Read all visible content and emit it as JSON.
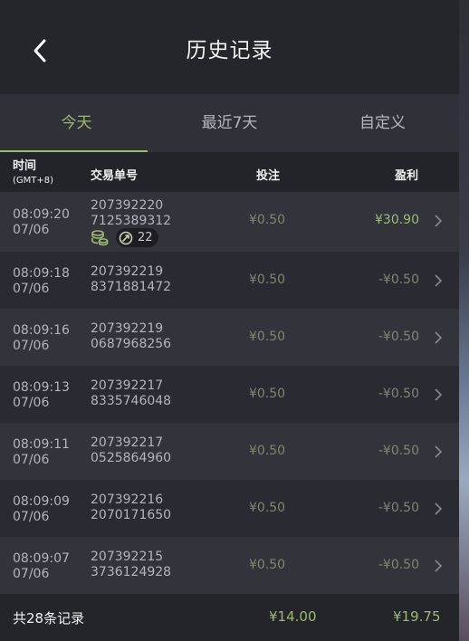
{
  "header": {
    "title": "历史记录"
  },
  "tabs": [
    {
      "label": "今天",
      "active": true
    },
    {
      "label": "最近7天",
      "active": false
    },
    {
      "label": "自定义",
      "active": false
    }
  ],
  "columns": {
    "time": "时间",
    "timezone": "(GMT+8)",
    "order": "交易单号",
    "bet": "投注",
    "profit": "盈利"
  },
  "records": [
    {
      "time": "08:09:20",
      "date": "07/06",
      "order_line1": "207392220",
      "order_line2": "7125389312",
      "bet": "¥0.50",
      "profit": "¥30.90",
      "win": true,
      "badge_count": "22"
    },
    {
      "time": "08:09:18",
      "date": "07/06",
      "order_line1": "207392219",
      "order_line2": "8371881472",
      "bet": "¥0.50",
      "profit": "-¥0.50",
      "win": false
    },
    {
      "time": "08:09:16",
      "date": "07/06",
      "order_line1": "207392219",
      "order_line2": "0687968256",
      "bet": "¥0.50",
      "profit": "-¥0.50",
      "win": false
    },
    {
      "time": "08:09:13",
      "date": "07/06",
      "order_line1": "207392217",
      "order_line2": "8335746048",
      "bet": "¥0.50",
      "profit": "-¥0.50",
      "win": false
    },
    {
      "time": "08:09:11",
      "date": "07/06",
      "order_line1": "207392217",
      "order_line2": "0525864960",
      "bet": "¥0.50",
      "profit": "-¥0.50",
      "win": false
    },
    {
      "time": "08:09:09",
      "date": "07/06",
      "order_line1": "207392216",
      "order_line2": "2070171650",
      "bet": "¥0.50",
      "profit": "-¥0.50",
      "win": false
    },
    {
      "time": "08:09:07",
      "date": "07/06",
      "order_line1": "207392215",
      "order_line2": "3736124928",
      "bet": "¥0.50",
      "profit": "-¥0.50",
      "win": false
    }
  ],
  "footer": {
    "total_label": "共28条记录",
    "total_bet": "¥14.00",
    "total_profit": "¥19.75"
  },
  "colors": {
    "accent": "#9dbb6e",
    "muted_value": "#7f8670",
    "background": "#2b2b33"
  },
  "icons": {
    "back": "chevron-left-icon",
    "row_arrow": "chevron-right-icon",
    "coins": "coins-icon",
    "spin": "refresh-icon"
  }
}
